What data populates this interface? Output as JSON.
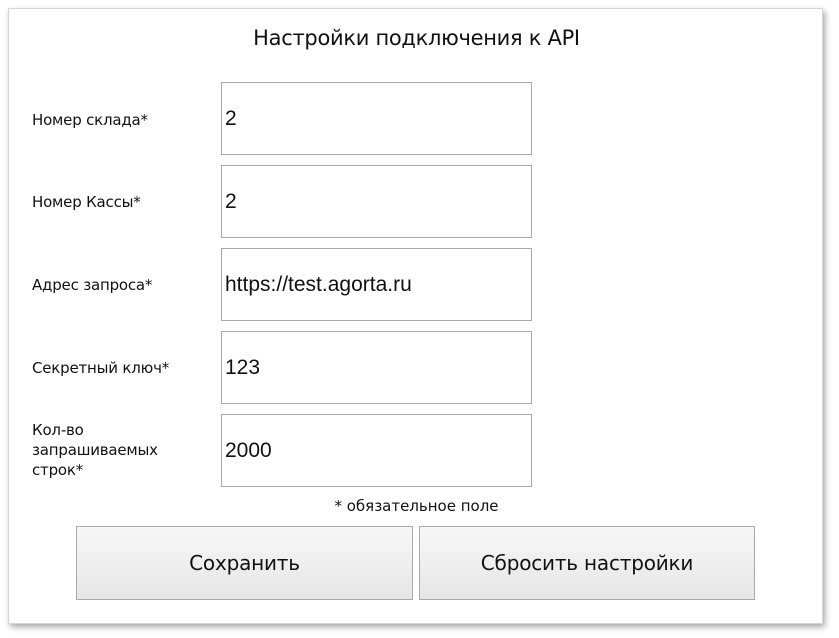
{
  "form": {
    "title": "Настройки подключения к API",
    "fields": [
      {
        "label": "Номер склада*",
        "value": "2"
      },
      {
        "label": "Номер Кассы*",
        "value": "2"
      },
      {
        "label": "Адрес запроса*",
        "value": "https://test.agorta.ru"
      },
      {
        "label": "Секретный ключ*",
        "value": "123"
      },
      {
        "label": "Кол-во запрашиваемых строк*",
        "value": "2000"
      }
    ],
    "required_note": "* обязательное поле",
    "save_label": "Сохранить",
    "reset_label": "Сбросить настройки"
  }
}
